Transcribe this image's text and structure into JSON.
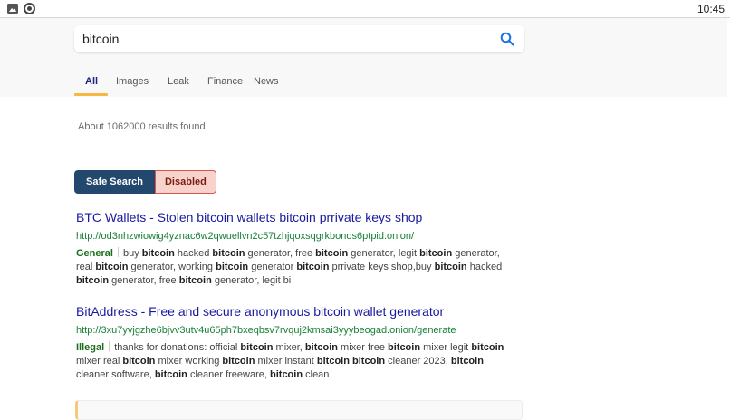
{
  "status_bar": {
    "time": "10:45",
    "icons": [
      "image-icon",
      "circle-icon"
    ]
  },
  "search": {
    "value": "bitcoin",
    "icon": "search-icon"
  },
  "tabs": [
    {
      "label": "All",
      "active": true
    },
    {
      "label": "Images",
      "active": false
    },
    {
      "label": "Leak",
      "active": false
    },
    {
      "label": "Finance",
      "active": false
    },
    {
      "label": "News",
      "active": false
    }
  ],
  "results_count": "About 1062000 results found",
  "safe_search": {
    "label": "Safe Search",
    "state": "Disabled"
  },
  "results": [
    {
      "title": "BTC Wallets - Stolen bitcoin wallets bitcoin prrivate keys shop",
      "url": "http://od3nhzwiowig4yznac6w2qwuellvn2c57tzhjqoxsqgrkbonos6ptpid.onion/",
      "category": "General",
      "snippet": [
        "buy ",
        "bitcoin",
        " hacked ",
        "bitcoin",
        " generator, free ",
        "bitcoin",
        " generator, legit ",
        "bitcoin",
        " generator, real ",
        "bitcoin",
        " generator, working ",
        "bitcoin",
        " generator ",
        "bitcoin",
        " prrivate keys shop,buy ",
        "bitcoin",
        " hacked ",
        "bitcoin",
        " generator, free ",
        "bitcoin",
        " generator, legit bi"
      ]
    },
    {
      "title": "BitAddress - Free and secure anonymous bitcoin wallet generator",
      "url": "http://3xu7yvjgzhe6bjvv3utv4u65ph7bxeqbsv7rvquj2kmsai3yyybeogad.onion/generate",
      "category": "Illegal",
      "snippet": [
        "thanks for donations: official ",
        "bitcoin",
        " mixer, ",
        "bitcoin",
        " mixer free ",
        "bitcoin",
        " mixer legit ",
        "bitcoin",
        " mixer real ",
        "bitcoin",
        " mixer working ",
        "bitcoin",
        " mixer instant ",
        "bitcoin",
        " ",
        "bitcoin",
        " cleaner 2023, ",
        "bitcoin",
        " cleaner software, ",
        "bitcoin",
        " cleaner freeware, ",
        "bitcoin",
        " clean"
      ]
    }
  ],
  "colors": {
    "accent": "#f5b742",
    "safe_search_bg": "#23486d",
    "disabled_bg": "#f8d3cb",
    "title_link": "#1a1aa0",
    "url": "#188038"
  }
}
